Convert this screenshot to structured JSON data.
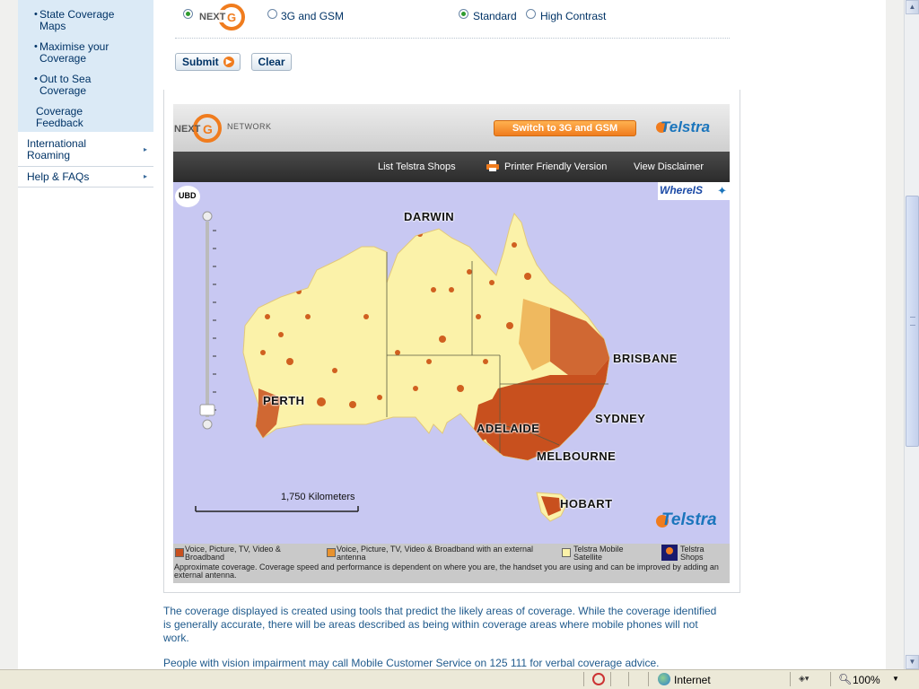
{
  "leftnav": {
    "sub_items": [
      "State Coverage Maps",
      "Maximise your Coverage",
      "Out to Sea Coverage"
    ],
    "coverage_feedback": "Coverage Feedback",
    "main_items": [
      "International Roaming",
      "Help & FAQs"
    ]
  },
  "form": {
    "network_options": [
      "3G and GSM"
    ],
    "display_options": [
      "Standard",
      "High Contrast"
    ],
    "submit_label": "Submit",
    "clear_label": "Clear"
  },
  "map": {
    "header": {
      "brand_logo_text": "NEXT G",
      "brand_network_text": "NETWORK",
      "switch_button": "Switch to 3G and GSM",
      "telstra_logo": "Telstra"
    },
    "toolbar": {
      "list_shops": "List Telstra Shops",
      "printer_friendly": "Printer Friendly Version",
      "view_disclaimer": "View Disclaimer"
    },
    "badges": {
      "ubd": "UBD",
      "whereis": "WhereIS"
    },
    "cities": [
      "DARWIN",
      "BRISBANE",
      "PERTH",
      "SYDNEY",
      "ADELAIDE",
      "MELBOURNE",
      "HOBART"
    ],
    "scale_label": "1,750 Kilometers",
    "watermark": "Telstra",
    "colors": {
      "water": "#c8c8f2",
      "land": "#fbf2a9",
      "coverage_dark": "#c8501e",
      "coverage_light": "#e8922e"
    }
  },
  "legend": {
    "items": [
      {
        "label": "Voice, Picture, TV, Video & Broadband",
        "color": "#c8501e"
      },
      {
        "label": "Voice, Picture, TV, Video & Broadband with an external antenna",
        "color": "#e8922e"
      },
      {
        "label": "Telstra Mobile Satellite",
        "color": "#fbf2a9"
      },
      {
        "label": "Telstra Shops",
        "color": "#1a1a6e"
      }
    ],
    "note": "Approximate coverage. Coverage speed and performance is dependent on where you are, the handset you are using and can be improved by adding an external antenna."
  },
  "paragraphs": [
    "The coverage displayed is created using tools that predict the likely areas of coverage. While the coverage identified is generally accurate, there will be areas described as being within coverage areas where mobile phones will not work.",
    "People with vision impairment may call Mobile Customer Service on 125 111 for verbal coverage advice."
  ],
  "statusbar": {
    "zone": "Internet",
    "zoom": "100%"
  }
}
